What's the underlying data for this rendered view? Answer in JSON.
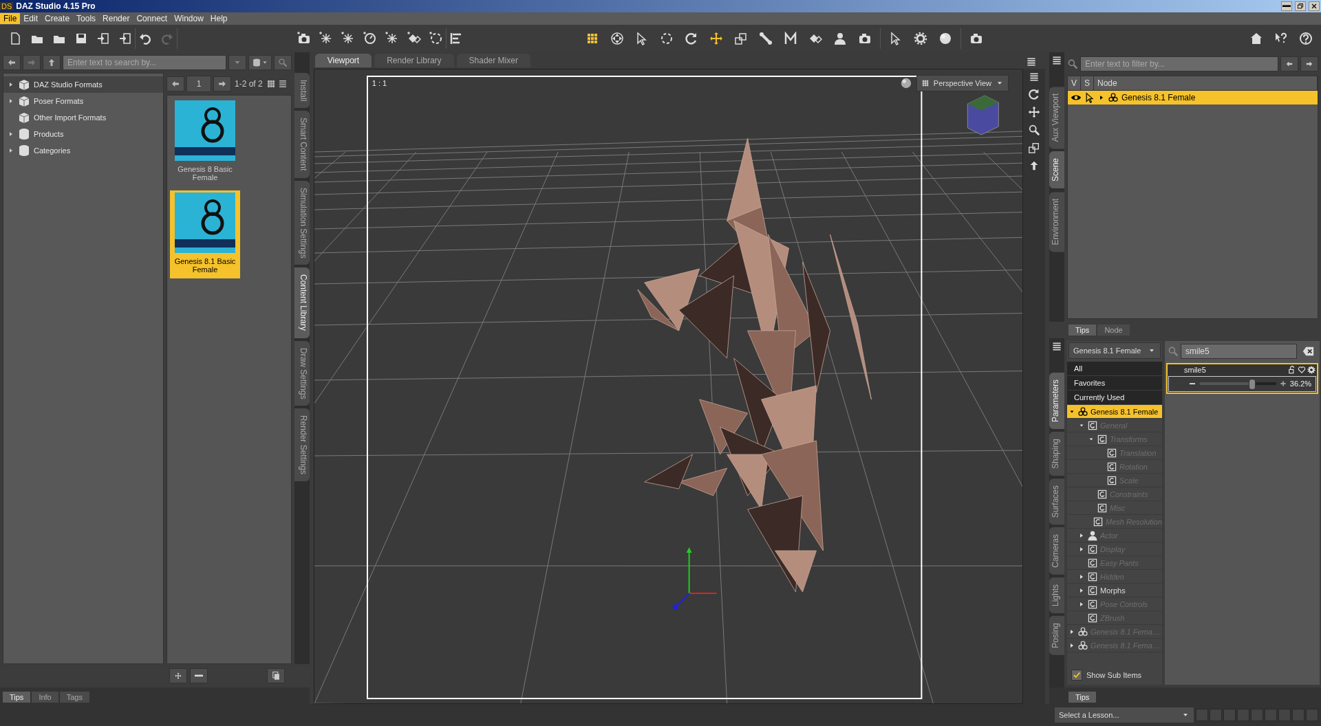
{
  "window": {
    "app_icon": "DS",
    "title": "DAZ Studio 4.15 Pro"
  },
  "menu": [
    {
      "label": "File",
      "selected": true
    },
    {
      "label": "Edit",
      "selected": false
    },
    {
      "label": "Create",
      "selected": false
    },
    {
      "label": "Tools",
      "selected": false
    },
    {
      "label": "Render",
      "selected": false
    },
    {
      "label": "Connect",
      "selected": false
    },
    {
      "label": "Window",
      "selected": false
    },
    {
      "label": "Help",
      "selected": false
    }
  ],
  "toolbar": {
    "tools": [
      {
        "selected": true
      },
      {
        "selected": false
      },
      {
        "selected": false
      },
      {
        "selected": false
      },
      {
        "selected": false
      },
      {
        "selected": true
      },
      {
        "selected": false
      },
      {
        "selected": false
      },
      {
        "selected": false
      },
      {
        "selected": false
      },
      {
        "selected": false
      },
      {
        "selected": false
      },
      {
        "selected": false
      },
      {
        "selected": false
      },
      {
        "selected": false
      },
      {
        "selected": false
      }
    ]
  },
  "content_library": {
    "search": {
      "placeholder": "Enter text to search by..."
    },
    "folders": [
      {
        "label": "DAZ Studio Formats",
        "expanded": false,
        "selected": true
      },
      {
        "label": "Poser Formats",
        "expanded": false,
        "selected": false
      },
      {
        "label": "Other Import Formats",
        "selected": false
      },
      {
        "label": "Products",
        "expanded": false,
        "selected": false
      },
      {
        "label": "Categories",
        "expanded": false,
        "selected": false
      }
    ],
    "page": "1",
    "page_range": "1-2 of 2",
    "products": [
      {
        "label": "Genesis 8 Basic Female",
        "selected": false
      },
      {
        "label": "Genesis 8.1 Basic Female",
        "selected": true
      }
    ],
    "side_tabs": [
      {
        "label": "Install",
        "selected": false
      },
      {
        "label": "Smart Content",
        "selected": false
      },
      {
        "label": "Simulation Settings",
        "selected": false
      },
      {
        "label": "Content Library",
        "selected": true
      },
      {
        "label": "Draw Settings",
        "selected": false
      },
      {
        "label": "Render Settings",
        "selected": false
      }
    ],
    "bottom_tabs": [
      {
        "label": "Tips",
        "selected": true
      },
      {
        "label": "Info",
        "selected": false
      },
      {
        "label": "Tags",
        "selected": false
      }
    ]
  },
  "viewport": {
    "tabs": [
      {
        "label": "Viewport",
        "selected": true
      },
      {
        "label": "Render Library",
        "selected": false
      },
      {
        "label": "Shader Mixer",
        "selected": false
      }
    ],
    "ratio": "1 : 1",
    "view": "Perspective View"
  },
  "scene": {
    "side_tabs": [
      {
        "label": "Aux Viewport",
        "selected": false
      },
      {
        "label": "Scene",
        "selected": true
      },
      {
        "label": "Environment",
        "selected": false
      }
    ],
    "filter": {
      "placeholder": "Enter text to filter by..."
    },
    "columns": [
      "V",
      "S",
      "Node"
    ],
    "nodes": [
      {
        "label": "Genesis 8.1 Female",
        "selected": true
      }
    ]
  },
  "info_tabs": [
    {
      "label": "Tips",
      "selected": true
    },
    {
      "label": "Node",
      "selected": false
    }
  ],
  "parameters": {
    "side_tabs": [
      {
        "label": "Parameters",
        "selected": true
      },
      {
        "label": "Shaping",
        "selected": false
      },
      {
        "label": "Surfaces",
        "selected": false
      },
      {
        "label": "Cameras",
        "selected": false
      },
      {
        "label": "Lights",
        "selected": false
      },
      {
        "label": "Posing",
        "selected": false
      }
    ],
    "node_select": "Genesis 8.1 Female",
    "filters": [
      {
        "label": "All",
        "selected": false
      },
      {
        "label": "Favorites",
        "selected": false
      },
      {
        "label": "Currently Used",
        "selected": false
      }
    ],
    "tree": [
      {
        "label": "Genesis 8.1 Female",
        "kind": "figure",
        "expanded": true,
        "selected": true,
        "dimmed": false,
        "children": [
          {
            "label": "General",
            "kind": "group",
            "expanded": true,
            "selected": false,
            "dimmed": true,
            "children": [
              {
                "label": "Transforms",
                "kind": "group",
                "expanded": true,
                "selected": false,
                "dimmed": true,
                "children": [
                  {
                    "label": "Translation",
                    "kind": "group",
                    "selected": false,
                    "dimmed": true
                  },
                  {
                    "label": "Rotation",
                    "kind": "group",
                    "selected": false,
                    "dimmed": true
                  },
                  {
                    "label": "Scale",
                    "kind": "group",
                    "selected": false,
                    "dimmed": true
                  }
                ]
              },
              {
                "label": "Constraints",
                "kind": "group",
                "selected": false,
                "dimmed": true
              },
              {
                "label": "Misc",
                "kind": "group",
                "selected": false,
                "dimmed": true
              },
              {
                "label": "Mesh Resolution",
                "kind": "group",
                "selected": false,
                "dimmed": true
              }
            ]
          },
          {
            "label": "Actor",
            "kind": "actor",
            "expanded": false,
            "selected": false,
            "dimmed": true
          },
          {
            "label": "Display",
            "kind": "group",
            "expanded": false,
            "selected": false,
            "dimmed": true
          },
          {
            "label": "Easy Pants",
            "kind": "group",
            "selected": false,
            "dimmed": true
          },
          {
            "label": "Hidden",
            "kind": "group",
            "expanded": false,
            "selected": false,
            "dimmed": true
          },
          {
            "label": "Morphs",
            "kind": "group",
            "expanded": false,
            "selected": false,
            "dimmed": false
          },
          {
            "label": "Pose Controls",
            "kind": "group",
            "expanded": false,
            "selected": false,
            "dimmed": true
          },
          {
            "label": "ZBrush",
            "kind": "group",
            "selected": false,
            "dimmed": true
          }
        ]
      },
      {
        "label": "Genesis 8.1 Fema…",
        "kind": "figure",
        "expanded": false,
        "selected": false,
        "dimmed": true
      },
      {
        "label": "Genesis 8.1 Fema…",
        "kind": "figure",
        "expanded": false,
        "selected": false,
        "dimmed": true
      }
    ],
    "show_sub_items": {
      "label": "Show Sub Items",
      "checked": true
    },
    "search": {
      "value": "smile5"
    },
    "properties": [
      {
        "label": "smile5",
        "selected": true,
        "level": 0.68,
        "reading": "36.2%"
      }
    ],
    "bottom_tabs": [
      {
        "label": "Tips",
        "selected": true
      }
    ]
  },
  "status_bar": {
    "lesson": {
      "placeholder": "Select a Lesson..."
    }
  }
}
